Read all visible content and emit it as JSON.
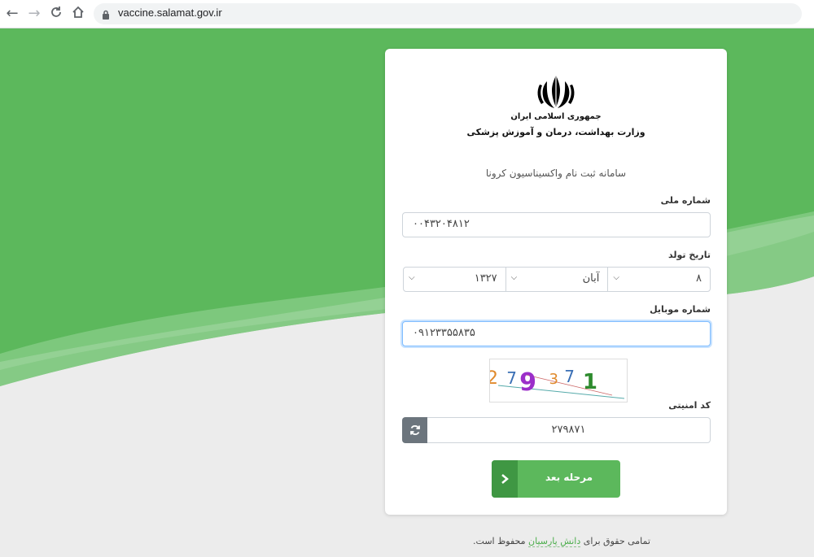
{
  "browser": {
    "url": "vaccine.salamat.gov.ir"
  },
  "header": {
    "ministry_line1": "جمهوری اسلامی ایران",
    "ministry_line2": "وزارت بهداشت، درمان و آموزش پزشکی",
    "system_title": "سامانه ثبت نام واکسیناسیون کرونا"
  },
  "form": {
    "national_id_label": "شماره ملی",
    "national_id_value": "۰۰۴۳۲۰۴۸۱۲",
    "birth_date_label": "تاریخ تولد",
    "birth_day": "۸",
    "birth_month": "آبان",
    "birth_year": "۱۳۲۷",
    "mobile_label": "شماره موبایل",
    "mobile_value": "۰۹۱۲۳۳۵۵۸۳۵",
    "captcha_image_text": "279371",
    "security_code_label": "کد امنیتی",
    "security_code_value": "۲۷۹۸۷۱",
    "next_button": "مرحله بعد"
  },
  "footer": {
    "text_before": "تمامی حقوق برای",
    "link": "دانش پارسیان",
    "text_after": "محفوظ است."
  },
  "colors": {
    "brand_green": "#5cb85c",
    "dark_green": "#3f9743"
  }
}
